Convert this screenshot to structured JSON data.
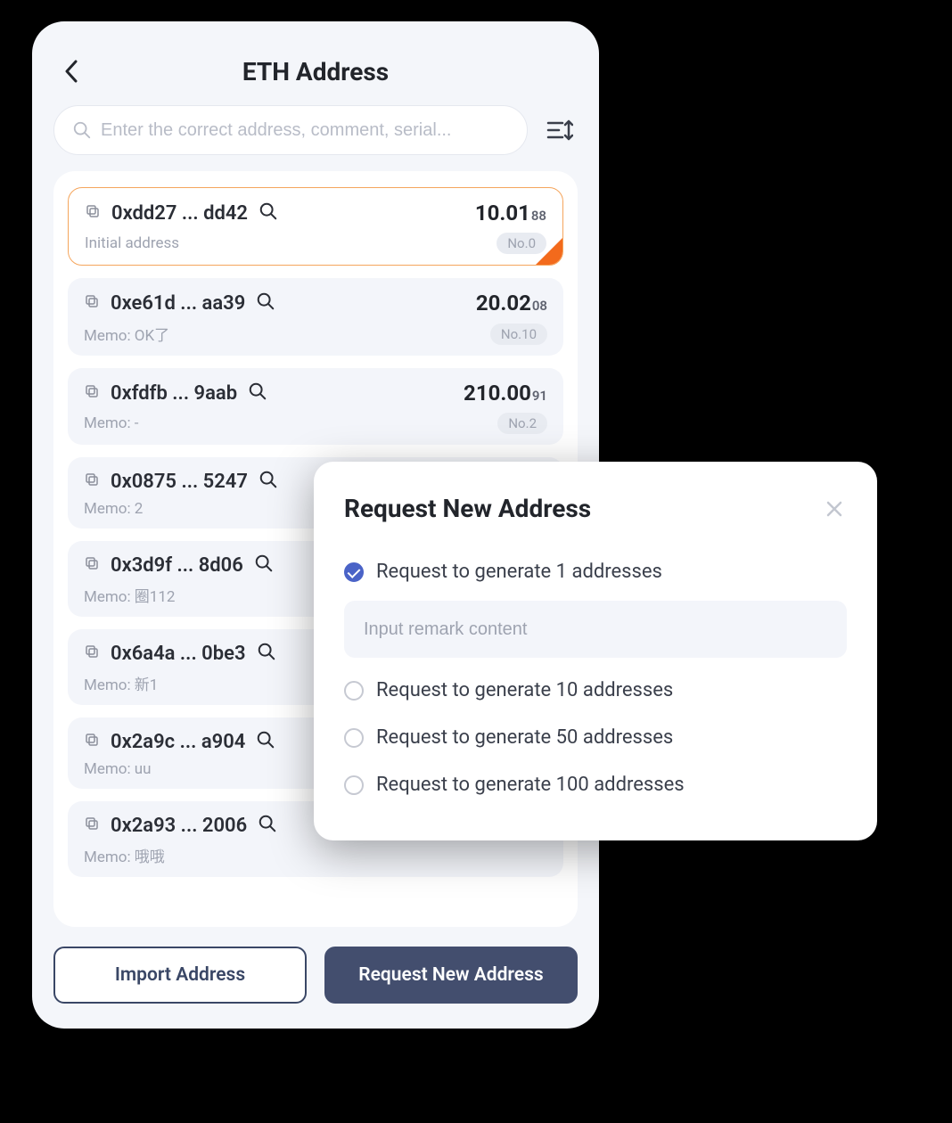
{
  "header": {
    "title": "ETH Address"
  },
  "search": {
    "placeholder": "Enter the correct address, comment, serial..."
  },
  "addresses": [
    {
      "addr": "0xdd27 ... dd42",
      "balance_int": "10.01",
      "balance_dec": "88",
      "memo": "Initial address",
      "badge": "No.0",
      "selected": true
    },
    {
      "addr": "0xe61d ... aa39",
      "balance_int": "20.02",
      "balance_dec": "08",
      "memo": "Memo: OK了",
      "badge": "No.10",
      "selected": false
    },
    {
      "addr": "0xfdfb ... 9aab",
      "balance_int": "210.00",
      "balance_dec": "91",
      "memo": "Memo: -",
      "badge": "No.2",
      "selected": false
    },
    {
      "addr": "0x0875 ... 5247",
      "balance_int": "",
      "balance_dec": "",
      "memo": "Memo: 2",
      "badge": "",
      "selected": false
    },
    {
      "addr": "0x3d9f ... 8d06",
      "balance_int": "",
      "balance_dec": "",
      "memo": "Memo: 圈112",
      "badge": "",
      "selected": false
    },
    {
      "addr": "0x6a4a ... 0be3",
      "balance_int": "",
      "balance_dec": "",
      "memo": "Memo: 新1",
      "badge": "",
      "selected": false
    },
    {
      "addr": "0x2a9c ... a904",
      "balance_int": "",
      "balance_dec": "",
      "memo": "Memo: uu",
      "badge": "",
      "selected": false
    },
    {
      "addr": "0x2a93 ... 2006",
      "balance_int": "",
      "balance_dec": "",
      "memo": "Memo: 哦哦",
      "badge": "",
      "selected": false
    }
  ],
  "footer": {
    "import_label": "Import Address",
    "request_label": "Request New Address"
  },
  "modal": {
    "title": "Request New Address",
    "options": [
      {
        "label": "Request to generate 1 addresses",
        "checked": true
      },
      {
        "label": "Request to generate 10 addresses",
        "checked": false
      },
      {
        "label": "Request to generate 50 addresses",
        "checked": false
      },
      {
        "label": "Request to generate 100 addresses",
        "checked": false
      }
    ],
    "remark_placeholder": "Input remark content"
  }
}
